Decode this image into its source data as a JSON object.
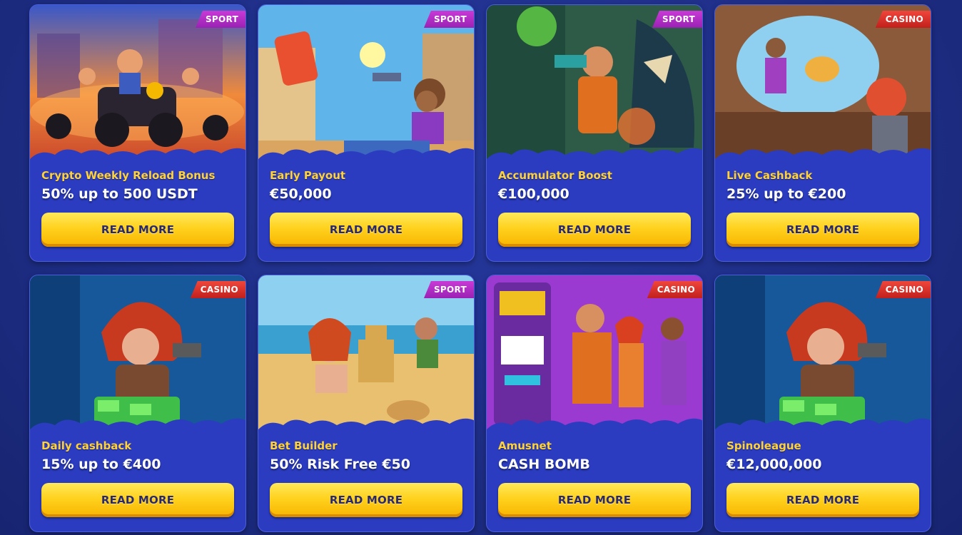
{
  "cards": [
    {
      "badge": "SPORT",
      "category": "Crypto Weekly Reload Bonus",
      "offer": "50% up to 500 USDT",
      "button": "READ MORE"
    },
    {
      "badge": "SPORT",
      "category": "Early Payout",
      "offer": "€50,000",
      "button": "READ MORE"
    },
    {
      "badge": "SPORT",
      "category": "Accumulator Boost",
      "offer": "€100,000",
      "button": "READ MORE"
    },
    {
      "badge": "CASINO",
      "category": "Live Cashback",
      "offer": "25% up to €200",
      "button": "READ MORE"
    },
    {
      "badge": "CASINO",
      "category": "Daily cashback",
      "offer": "15% up to €400",
      "button": "READ MORE"
    },
    {
      "badge": "SPORT",
      "category": "Bet Builder",
      "offer": "50% Risk Free €50",
      "button": "READ MORE"
    },
    {
      "badge": "CASINO",
      "category": "Amusnet",
      "offer": "CASH BOMB",
      "button": "READ MORE"
    },
    {
      "badge": "CASINO",
      "category": "Spinoleague",
      "offer": "€12,000,000",
      "button": "READ MORE"
    }
  ],
  "colors": {
    "sport": "#b02cc6",
    "casino": "#e2322b",
    "button": "#ffd21e",
    "card": "#2b3cc0",
    "category": "#ffd23a"
  }
}
